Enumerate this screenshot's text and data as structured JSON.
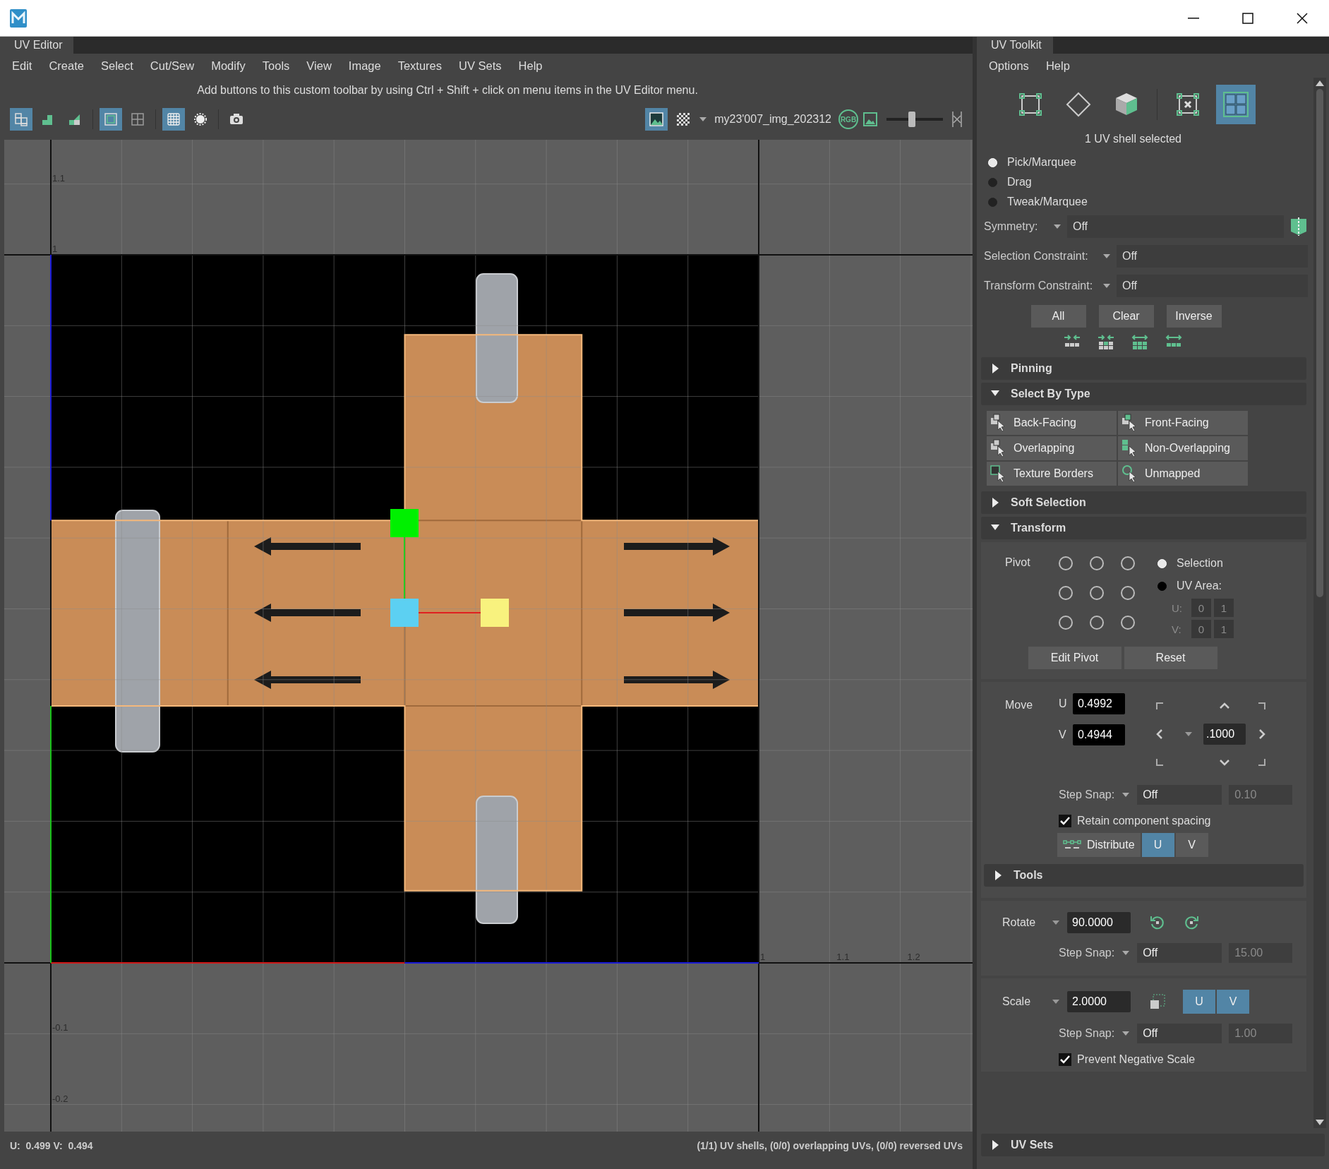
{
  "uv_editor": {
    "tab": "UV Editor",
    "menu": [
      "Edit",
      "Create",
      "Select",
      "Cut/Sew",
      "Modify",
      "Tools",
      "View",
      "Image",
      "Textures",
      "UV Sets",
      "Help"
    ],
    "toolbar_hint": "Add buttons to this custom toolbar by using Ctrl + Shift + click on menu items in the UV Editor menu.",
    "toolbar": {
      "tools": [
        {
          "selected": true
        },
        {
          "selected": false
        },
        {
          "selected": false
        },
        {
          "selected": true
        },
        {
          "selected": false
        },
        {
          "selected": true
        },
        {
          "selected": false
        },
        {
          "selected": false
        }
      ],
      "image_display": {
        "selected": true
      },
      "checker": {
        "selected": false
      },
      "image_name": "my23'007_img_202312",
      "rgb_badge": "RGB",
      "exposure": {
        "level": 0.45
      }
    },
    "canvas": {
      "v_labels": [
        "1.1",
        "1",
        "-0.1",
        "-0.2"
      ],
      "u_labels": [
        "1",
        "1.1",
        "1.2"
      ]
    },
    "status": {
      "cursor": "U:  0.499 V:  0.494",
      "summary": "(1/1) UV shells, (0/0) overlapping UVs, (0/0) reversed UVs"
    }
  },
  "uv_toolkit": {
    "tab": "UV Toolkit",
    "menu": [
      "Options",
      "Help"
    ],
    "modes": [
      {
        "selected": false
      },
      {
        "selected": false
      },
      {
        "selected": false
      },
      {
        "selected": false
      },
      {
        "selected": true
      }
    ],
    "summary": "1 UV shell selected",
    "tools": [
      {
        "label": "Pick/Marquee",
        "selected": true
      },
      {
        "label": "Drag",
        "selected": false
      },
      {
        "label": "Tweak/Marquee",
        "selected": false
      }
    ],
    "dropdowns": [
      {
        "label": "Symmetry:",
        "value": "Off"
      },
      {
        "label": "Selection Constraint:",
        "value": "Off"
      },
      {
        "label": "Transform Constraint:",
        "value": "Off"
      }
    ],
    "constraint_buttons": [
      "All",
      "Clear",
      "Inverse"
    ],
    "pinning": {
      "title": "Pinning",
      "expanded": false
    },
    "select_by_type": {
      "title": "Select By Type",
      "expanded": true,
      "buttons": [
        "Back-Facing",
        "Front-Facing",
        "Overlapping",
        "Non-Overlapping",
        "Texture Borders",
        "Unmapped"
      ]
    },
    "soft_selection": {
      "title": "Soft Selection",
      "expanded": false
    },
    "transform": {
      "title": "Transform",
      "expanded": true,
      "pivot": {
        "label": "Pivot",
        "points": [
          {
            "selected": false
          },
          {
            "selected": false
          },
          {
            "selected": false
          },
          {
            "selected": false
          },
          {
            "selected": false
          },
          {
            "selected": false
          },
          {
            "selected": false
          },
          {
            "selected": false
          },
          {
            "selected": false
          }
        ],
        "modes": [
          {
            "label": "Selection",
            "selected": true
          },
          {
            "label": "UV Area:",
            "selected": false
          }
        ],
        "area": {
          "disabled": true,
          "rows": [
            {
              "label": "U:",
              "min": "0",
              "max": "1"
            },
            {
              "label": "V:",
              "min": "0",
              "max": "1"
            }
          ]
        },
        "buttons": [
          "Edit Pivot",
          "Reset"
        ]
      },
      "move": {
        "label": "Move",
        "u_label": "U",
        "u": "0.4992",
        "v_label": "V",
        "v": "0.4944",
        "step": ".1000",
        "snap": {
          "label": "Step Snap:",
          "value": "Off",
          "amount": "0.10",
          "amount_disabled": true
        },
        "retain": {
          "label": "Retain component spacing",
          "checked": true
        },
        "distribute": {
          "label": "Distribute",
          "axes": [
            {
              "label": "U",
              "selected": true
            },
            {
              "label": "V",
              "selected": false
            }
          ]
        }
      },
      "tools": {
        "title": "Tools",
        "expanded": false
      },
      "rotate": {
        "label": "Rotate",
        "value": "90.0000",
        "snap": {
          "label": "Step Snap:",
          "value": "Off",
          "amount": "15.00",
          "amount_disabled": true
        }
      },
      "scale": {
        "label": "Scale",
        "value": "2.0000",
        "axes": [
          {
            "label": "U",
            "selected": true
          },
          {
            "label": "V",
            "selected": true
          }
        ],
        "snap": {
          "label": "Step Snap:",
          "value": "Off",
          "amount": "1.00",
          "amount_disabled": true
        },
        "prevent_negative": {
          "label": "Prevent Negative Scale",
          "checked": true
        }
      }
    },
    "uv_sets": {
      "title": "UV Sets",
      "expanded": false
    }
  }
}
